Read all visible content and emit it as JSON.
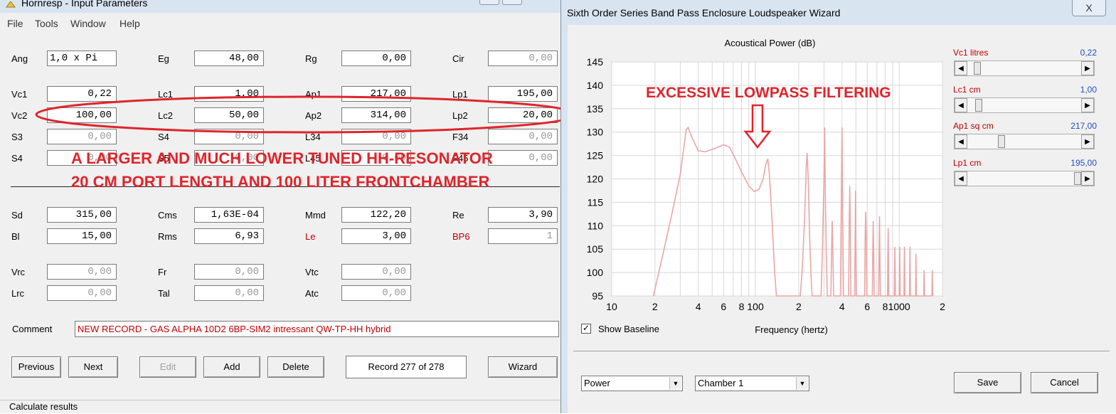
{
  "left_window": {
    "title": "Hornresp - Input Parameters",
    "menu": [
      "File",
      "Tools",
      "Window",
      "Help"
    ],
    "fields": [
      {
        "label": "Ang",
        "value": "1,0 x Pi",
        "align": "left"
      },
      {
        "label": "Eg",
        "value": "48,00"
      },
      {
        "label": "Rg",
        "value": "0,00"
      },
      {
        "label": "Cir",
        "value": "0,00",
        "disabled": true
      },
      {
        "label": "Vc1",
        "value": "0,22"
      },
      {
        "label": "Lc1",
        "value": "1,00"
      },
      {
        "label": "Ap1",
        "value": "217,00"
      },
      {
        "label": "Lp1",
        "value": "195,00"
      },
      {
        "label": "Vc2",
        "value": "100,00"
      },
      {
        "label": "Lc2",
        "value": "50,00"
      },
      {
        "label": "Ap2",
        "value": "314,00"
      },
      {
        "label": "Lp2",
        "value": "20,00"
      },
      {
        "label": "S3",
        "value": "0,00",
        "disabled": true
      },
      {
        "label": "S4",
        "value": "0,00",
        "disabled": true
      },
      {
        "label": "L34",
        "value": "0,00",
        "disabled": true
      },
      {
        "label": "F34",
        "value": "0,00",
        "disabled": true
      },
      {
        "label": "S4",
        "value": "0,00",
        "disabled": true
      },
      {
        "label": "S5",
        "value": "0,00",
        "disabled": true
      },
      {
        "label": "L45",
        "value": "0,00",
        "disabled": true
      },
      {
        "label": "F45",
        "value": "0,00",
        "disabled": true
      },
      {
        "label": "Sd",
        "value": "315,00"
      },
      {
        "label": "Cms",
        "value": "1,63E-04"
      },
      {
        "label": "Mmd",
        "value": "122,20"
      },
      {
        "label": "Re",
        "value": "3,90"
      },
      {
        "label": "Bl",
        "value": "15,00"
      },
      {
        "label": "Rms",
        "value": "6,93"
      },
      {
        "label": "Le",
        "value": "3,00",
        "red": true
      },
      {
        "label": "BP6",
        "value": "1",
        "red": true,
        "disabled": true
      },
      {
        "label": "Vrc",
        "value": "0,00",
        "disabled": true
      },
      {
        "label": "Fr",
        "value": "0,00",
        "disabled": true
      },
      {
        "label": "Vtc",
        "value": "0,00",
        "disabled": true
      },
      {
        "label": "Lrc",
        "value": "0,00",
        "disabled": true
      },
      {
        "label": "Tal",
        "value": "0,00",
        "disabled": true
      },
      {
        "label": "Atc",
        "value": "0,00",
        "disabled": true
      }
    ],
    "comment_label": "Comment",
    "comment_value": "NEW RECORD - GAS ALPHA 10D2 6BP-SIM2 intressant QW-TP-HH hybrid",
    "buttons": {
      "previous": "Previous",
      "next": "Next",
      "edit": "Edit",
      "add": "Add",
      "delete": "Delete",
      "wizard": "Wizard"
    },
    "record_text": "Record 277 of 278",
    "status": "Calculate results"
  },
  "annotations": {
    "line1": "A LARGER AND MUCH LOWER TUNED HH-RESONATOR",
    "line2": "20 CM PORT LENGTH AND 100 LITER FRONTCHAMBER",
    "plot_note": "EXCESSIVE LOWPASS FILTERING",
    "arrow_icon": "down-arrow-icon",
    "annotation_color": "#e0242b"
  },
  "wizard": {
    "title": "Sixth Order Series Band Pass Enclosure Loudspeaker Wizard",
    "close_label": "X",
    "sliders": [
      {
        "label": "Vc1  litres",
        "value": "0,22",
        "position": 0.06
      },
      {
        "label": "Lc1  cm",
        "value": "1,00",
        "position": 0.07
      },
      {
        "label": "Ap1  sq cm",
        "value": "217,00",
        "position": 0.28
      },
      {
        "label": "Lp1  cm",
        "value": "195,00",
        "position": 0.99
      }
    ],
    "baseline_checkbox": {
      "label": "Show Baseline",
      "checked": true
    },
    "view_select": "Power",
    "chamber_select": "Chamber 1",
    "save_label": "Save",
    "cancel_label": "Cancel"
  },
  "chart_data": {
    "type": "line",
    "title": "Acoustical Power (dB)",
    "xlabel": "Frequency (hertz)",
    "ylabel": "",
    "x_scale": "log",
    "xlim": [
      10,
      2000
    ],
    "ylim": [
      95,
      145
    ],
    "y_ticks": [
      95,
      100,
      105,
      110,
      115,
      120,
      125,
      130,
      135,
      140,
      145
    ],
    "x_tick_labels": [
      {
        "f": 10,
        "label": "10"
      },
      {
        "f": 20,
        "label": "2"
      },
      {
        "f": 40,
        "label": "4"
      },
      {
        "f": 60,
        "label": "6"
      },
      {
        "f": 80,
        "label": "8"
      },
      {
        "f": 100,
        "label": "100"
      },
      {
        "f": 200,
        "label": "2"
      },
      {
        "f": 400,
        "label": "4"
      },
      {
        "f": 600,
        "label": "6"
      },
      {
        "f": 800,
        "label": "8"
      },
      {
        "f": 1000,
        "label": "1000"
      },
      {
        "f": 2000,
        "label": "2"
      }
    ],
    "grid": true,
    "series": [
      {
        "color": "#eba6a6",
        "points": [
          [
            19.5,
            95
          ],
          [
            22,
            102
          ],
          [
            26,
            112
          ],
          [
            30,
            121
          ],
          [
            33,
            130.5
          ],
          [
            34,
            131
          ],
          [
            36,
            129
          ],
          [
            40,
            126
          ],
          [
            45,
            125.8
          ],
          [
            52,
            126.5
          ],
          [
            60,
            127.3
          ],
          [
            66,
            126.8
          ],
          [
            72,
            124.5
          ],
          [
            80,
            121.5
          ],
          [
            90,
            118.5
          ],
          [
            98,
            117.3
          ],
          [
            106,
            117.8
          ],
          [
            113,
            120
          ],
          [
            118,
            123
          ],
          [
            122,
            124.3
          ],
          [
            125,
            121
          ],
          [
            130,
            112
          ],
          [
            136,
            100
          ],
          [
            140,
            95
          ],
          [
            205,
            95
          ],
          [
            212,
            101
          ],
          [
            220,
            112
          ],
          [
            226,
            123
          ],
          [
            229,
            125.5
          ],
          [
            233,
            120
          ],
          [
            238,
            108
          ],
          [
            243,
            100
          ],
          [
            248,
            95
          ],
          [
            286,
            95
          ],
          [
            292,
            104
          ],
          [
            299,
            118
          ],
          [
            303,
            131
          ],
          [
            306,
            118
          ],
          [
            311,
            104
          ],
          [
            316,
            95
          ],
          [
            335,
            95
          ],
          [
            338,
            104
          ],
          [
            342,
            111
          ],
          [
            346,
            104
          ],
          [
            350,
            95
          ],
          [
            390,
            95
          ],
          [
            395,
            112
          ],
          [
            400,
            131
          ],
          [
            405,
            112
          ],
          [
            410,
            95
          ],
          [
            445,
            95
          ],
          [
            449,
            110
          ],
          [
            453,
            118.5
          ],
          [
            457,
            110
          ],
          [
            461,
            95
          ],
          [
            490,
            95
          ],
          [
            494,
            108
          ],
          [
            497,
            117.5
          ],
          [
            500,
            108
          ],
          [
            504,
            95
          ],
          [
            575,
            95
          ],
          [
            580,
            108
          ],
          [
            585,
            113
          ],
          [
            590,
            108
          ],
          [
            595,
            95
          ],
          [
            650,
            95
          ],
          [
            655,
            104
          ],
          [
            660,
            111
          ],
          [
            665,
            104
          ],
          [
            670,
            95
          ],
          [
            720,
            95
          ],
          [
            725,
            104
          ],
          [
            730,
            112
          ],
          [
            735,
            104
          ],
          [
            740,
            95
          ],
          [
            830,
            95
          ],
          [
            834,
            103
          ],
          [
            838,
            109.5
          ],
          [
            842,
            103
          ],
          [
            846,
            95
          ],
          [
            925,
            95
          ],
          [
            929,
            101
          ],
          [
            933,
            105.5
          ],
          [
            937,
            101
          ],
          [
            941,
            95
          ],
          [
            1000,
            95
          ],
          [
            1004,
            101
          ],
          [
            1008,
            105.5
          ],
          [
            1012,
            101
          ],
          [
            1016,
            95
          ],
          [
            1080,
            95
          ],
          [
            1084,
            101
          ],
          [
            1088,
            105.5
          ],
          [
            1092,
            101
          ],
          [
            1096,
            95
          ],
          [
            1180,
            95
          ],
          [
            1184,
            101
          ],
          [
            1188,
            105.5
          ],
          [
            1192,
            101
          ],
          [
            1196,
            95
          ],
          [
            1300,
            95
          ],
          [
            1304,
            100
          ],
          [
            1308,
            104
          ],
          [
            1312,
            100
          ],
          [
            1316,
            95
          ],
          [
            1480,
            95
          ],
          [
            1485,
            98
          ],
          [
            1490,
            100.5
          ],
          [
            1495,
            98
          ],
          [
            1500,
            95
          ],
          [
            1690,
            95
          ],
          [
            1695,
            98
          ],
          [
            1700,
            100.5
          ],
          [
            1705,
            98
          ],
          [
            1710,
            95
          ]
        ]
      }
    ]
  }
}
